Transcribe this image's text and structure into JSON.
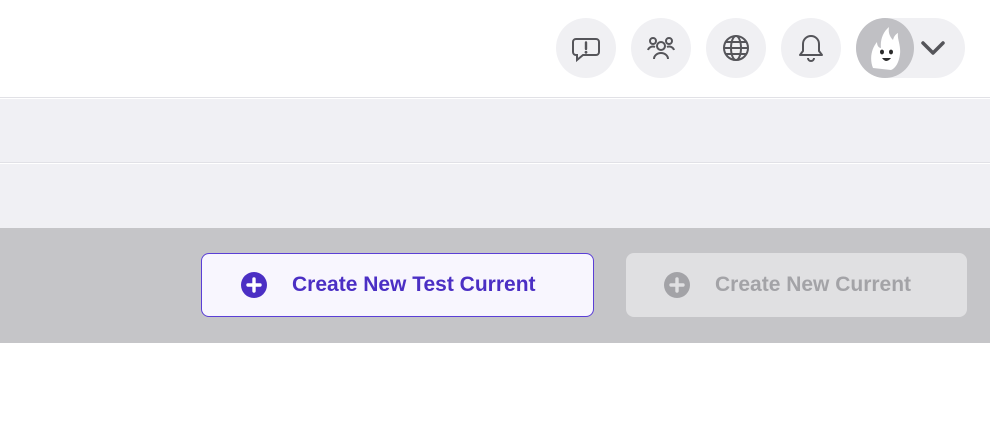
{
  "header": {
    "icons": [
      {
        "name": "feedback-icon"
      },
      {
        "name": "users-icon"
      },
      {
        "name": "globe-icon"
      },
      {
        "name": "bell-icon"
      }
    ],
    "profile_menu": {
      "avatar": "avatar",
      "caret": "chevron-down-icon"
    }
  },
  "actions": {
    "create_test_current_label": "Create New Test Current",
    "create_current_label": "Create New Current",
    "create_current_disabled": true
  },
  "colors": {
    "accent": "#4b2fc4",
    "disabled_text": "#a3a3a7",
    "icon_bg": "#f0f0f3",
    "action_bar_bg": "#c5c5c8"
  }
}
